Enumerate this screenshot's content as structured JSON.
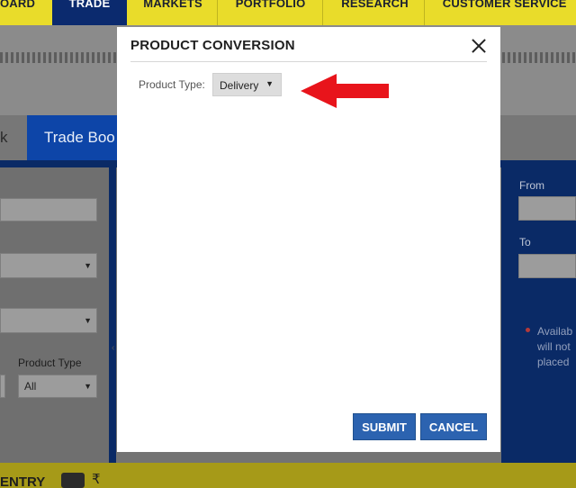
{
  "nav": {
    "items": [
      {
        "label": "OARD"
      },
      {
        "label": "TRADE"
      },
      {
        "label": "MARKETS"
      },
      {
        "label": "PORTFOLIO"
      },
      {
        "label": "RESEARCH"
      },
      {
        "label": "CUSTOMER SERVICE"
      }
    ],
    "active": "TRADE"
  },
  "tabs": {
    "partial_left": "k",
    "trade_book": "Trade Boo"
  },
  "left_panel": {
    "product_type_label": "Product Type",
    "product_type_value": "All"
  },
  "right_panel": {
    "from_label": "From",
    "to_label": "To",
    "warning_lines": [
      "Availab",
      "will not",
      "placed"
    ]
  },
  "bottom_bar": {
    "entry_label": "ENTRY",
    "currency_symbol": "₹"
  },
  "modal": {
    "title": "PRODUCT CONVERSION",
    "product_type_label": "Product Type:",
    "product_type_value": "Delivery",
    "submit_label": "SUBMIT",
    "cancel_label": "CANCEL"
  },
  "colors": {
    "nav_yellow": "#e9dc2a",
    "active_tab_blue": "#0d45a8",
    "button_blue": "#2c63b0",
    "annotation_arrow_red": "#e8141b"
  }
}
